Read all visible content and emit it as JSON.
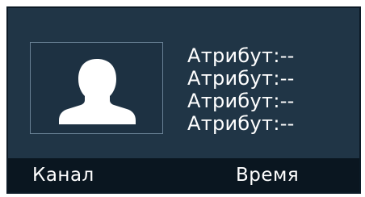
{
  "photo": {
    "icon": "person-silhouette-icon"
  },
  "attributes": [
    {
      "label": "Атрибут",
      "separator": ":",
      "value": "--"
    },
    {
      "label": "Атрибут",
      "separator": ":",
      "value": "--"
    },
    {
      "label": "Атрибут",
      "separator": ":",
      "value": "--"
    },
    {
      "label": "Атрибут",
      "separator": ":",
      "value": "--"
    }
  ],
  "footer": {
    "channel_label": "Канал",
    "time_label": "Время"
  },
  "colors": {
    "panel_background": "#203546",
    "footer_background": "#0a1620",
    "text": "#ffffff"
  }
}
